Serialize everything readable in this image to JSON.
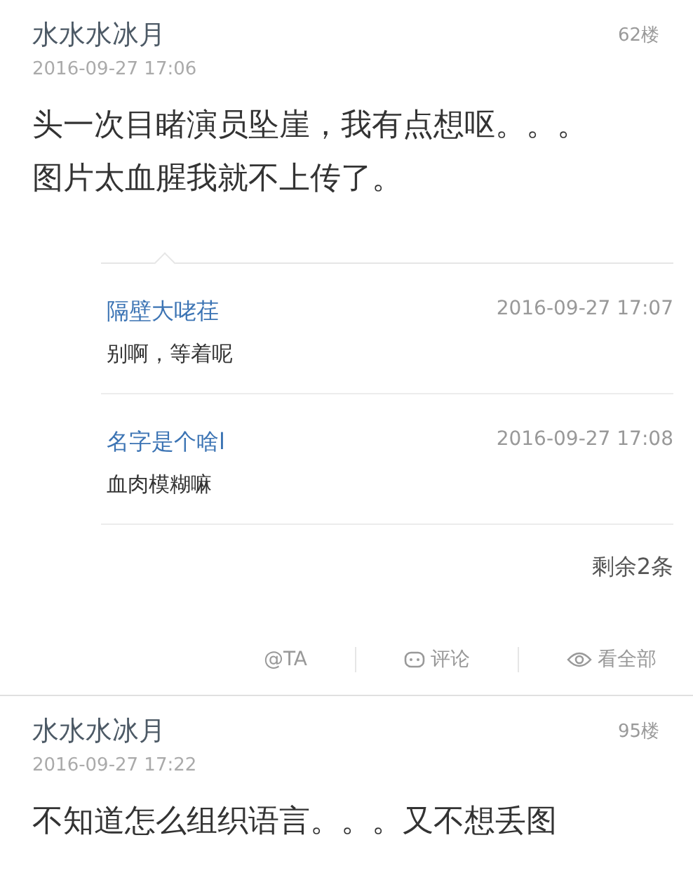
{
  "posts": [
    {
      "author": "水水水冰月",
      "floor": "62楼",
      "time": "2016-09-27 17:06",
      "content": [
        "头一次目睹演员坠崖，我有点想呕。。。",
        "图片太血腥我就不上传了。"
      ],
      "replies": [
        {
          "author": "隔壁大咾荏",
          "time": "2016-09-27 17:07",
          "text": "别啊，等着呢"
        },
        {
          "author": "名字是个啥l",
          "time": "2016-09-27 17:08",
          "text": "血肉模糊嘛"
        }
      ],
      "more": "剩余2条",
      "actions": [
        {
          "kind": "at",
          "label": "@TA"
        },
        {
          "kind": "comment",
          "label": "评论"
        },
        {
          "kind": "view",
          "label": "看全部"
        }
      ]
    },
    {
      "author": "水水水冰月",
      "floor": "95楼",
      "time": "2016-09-27 17:22",
      "content": [
        "不知道怎么组织语言。。。又不想丢图"
      ]
    }
  ]
}
